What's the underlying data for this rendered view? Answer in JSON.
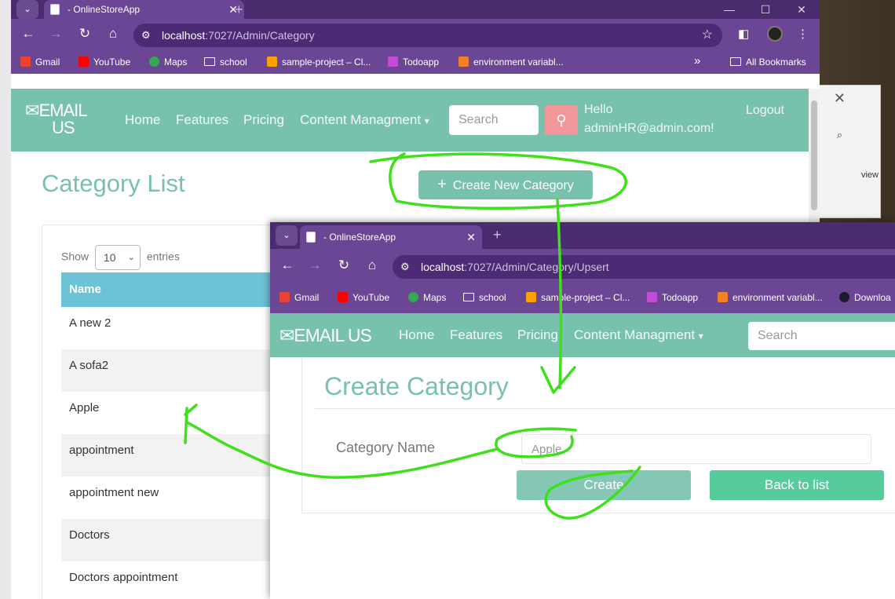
{
  "colors": {
    "accent": "#78c2ad",
    "danger": "#f3969a",
    "table_head": "#6cc3d5",
    "success": "#56cc9d",
    "chrome": "#6b4694",
    "annotation": "#3ee01a"
  },
  "browser_main": {
    "tab_title": "- OnlineStoreApp",
    "url_host": "localhost",
    "url_path": ":7027/Admin/Category",
    "bookmarks": [
      "Gmail",
      "YouTube",
      "Maps",
      "school",
      "sample-project – Cl...",
      "Todoapp",
      "environment variabl..."
    ],
    "more_bookmarks": "»",
    "all_bookmarks": "All Bookmarks"
  },
  "browser_popup": {
    "tab_title": "- OnlineStoreApp",
    "url_host": "localhost",
    "url_path": ":7027/Admin/Category/Upsert",
    "bookmarks": [
      "Gmail",
      "YouTube",
      "Maps",
      "school",
      "sample-project – Cl...",
      "Todoapp",
      "environment variabl...",
      "Downloa"
    ]
  },
  "site": {
    "brand_line1": "EMAIL",
    "brand_line2": "US",
    "brand_single": "EMAIL US",
    "nav": [
      "Home",
      "Features",
      "Pricing",
      "Content Managment"
    ],
    "dropdown_caret": "▾",
    "search_placeholder": "Search",
    "hello_line1": "Hello",
    "hello_line2": "adminHR@admin.com!",
    "logout": "Logout"
  },
  "category_list": {
    "title": "Category List",
    "create_button": "Create New Category",
    "show_label": "Show",
    "entries_value": "10",
    "entries_label": "entries",
    "column_name": "Name",
    "rows": [
      "A new 2",
      "A sofa2",
      "Apple",
      "appointment",
      "appointment new",
      "Doctors",
      "Doctors appointment"
    ]
  },
  "create_category": {
    "title": "Create Category",
    "field_label": "Category Name",
    "field_value": "Apple",
    "create_button": "Create",
    "back_button": "Back to list"
  },
  "bg_window": {
    "search_glyph": "⌕",
    "partial_text": "view",
    "close": "✕"
  }
}
